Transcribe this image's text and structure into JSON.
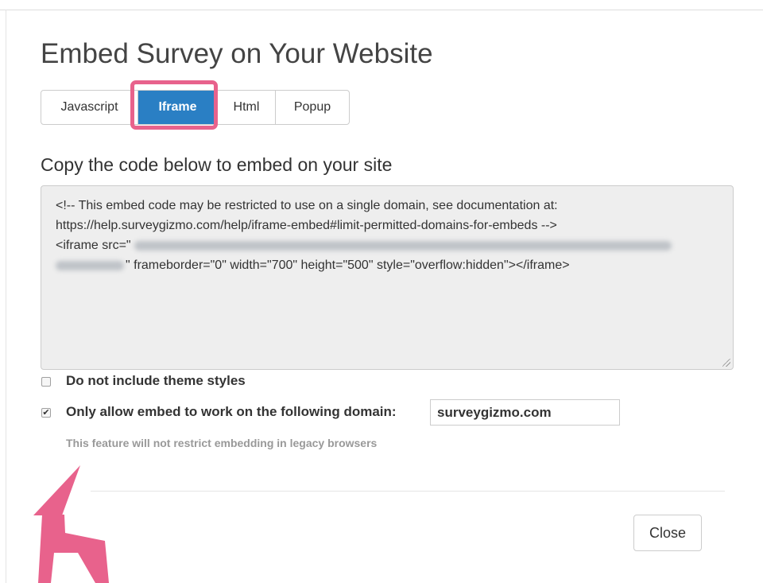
{
  "dialog": {
    "title": "Embed Survey on Your Website",
    "tabs": [
      {
        "label": "Javascript",
        "active": false
      },
      {
        "label": "Iframe",
        "active": true
      },
      {
        "label": "Html",
        "active": false
      },
      {
        "label": "Popup",
        "active": false
      }
    ],
    "subheading": "Copy the code below to embed on your site",
    "code": {
      "line1": "<!-- This embed code may be restricted to use on a single domain, see documentation at:",
      "line2": "https://help.surveygizmo.com/help/iframe-embed#limit-permitted-domains-for-embeds -->",
      "line3_prefix": "<iframe src=\"",
      "line4_suffix": "\" frameborder=\"0\" width=\"700\" height=\"500\" style=\"overflow:hidden\"></iframe>"
    },
    "options": {
      "theme_styles_label": "Do not include theme styles",
      "theme_styles_checked": false,
      "domain_restrict_label": "Only allow embed to work on the following domain:",
      "domain_restrict_checked": true,
      "domain_value": "surveygizmo.com",
      "help_text": "This feature will not restrict embedding in legacy browsers"
    },
    "close_label": "Close"
  },
  "colors": {
    "active_tab": "#2a7fc4",
    "annotation": "#e8628c",
    "code_background": "#eeeeee"
  }
}
